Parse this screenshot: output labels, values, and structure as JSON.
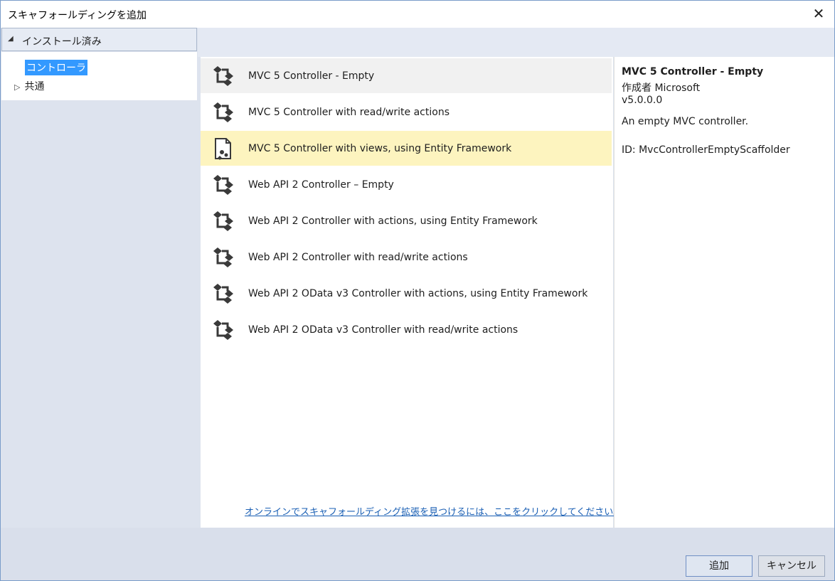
{
  "window": {
    "title": "スキャフォールディングを追加",
    "close_glyph": "✕"
  },
  "left": {
    "installed_label": "インストール済み",
    "installed_icon": "◢",
    "tree": [
      {
        "label": "コントローラ"
      },
      {
        "label": "共通",
        "expander": "▷"
      }
    ]
  },
  "list": {
    "items": [
      {
        "label": "MVC 5 Controller - Empty",
        "icon": "controller-icon"
      },
      {
        "label": "MVC 5 Controller with read/write actions",
        "icon": "controller-icon"
      },
      {
        "label": "MVC 5 Controller with views, using Entity Framework",
        "icon": "controller-views-icon"
      },
      {
        "label": "Web API 2 Controller – Empty",
        "icon": "controller-icon"
      },
      {
        "label": "Web API 2 Controller with actions, using Entity Framework",
        "icon": "controller-icon"
      },
      {
        "label": "Web API 2 Controller with read/write actions",
        "icon": "controller-icon"
      },
      {
        "label": "Web API 2 OData v3 Controller with actions, using Entity Framework",
        "icon": "controller-icon"
      },
      {
        "label": "Web API 2 OData v3 Controller with read/write actions",
        "icon": "controller-icon"
      }
    ],
    "online_link": "オンラインでスキャフォールディング拡張を見つけるには、ここをクリックしてください。"
  },
  "detail": {
    "title": "MVC 5 Controller - Empty",
    "author": "作成者 Microsoft",
    "version": "v5.0.0.0",
    "description": "An empty MVC controller.",
    "id": "ID: MvcControllerEmptyScaffolder"
  },
  "footer": {
    "add_label": "追加",
    "cancel_label": "キャンセル"
  },
  "colors": {
    "selection_blue": "#3399ff",
    "selected_row": "#fdf4bf",
    "link": "#1a5fb4"
  }
}
